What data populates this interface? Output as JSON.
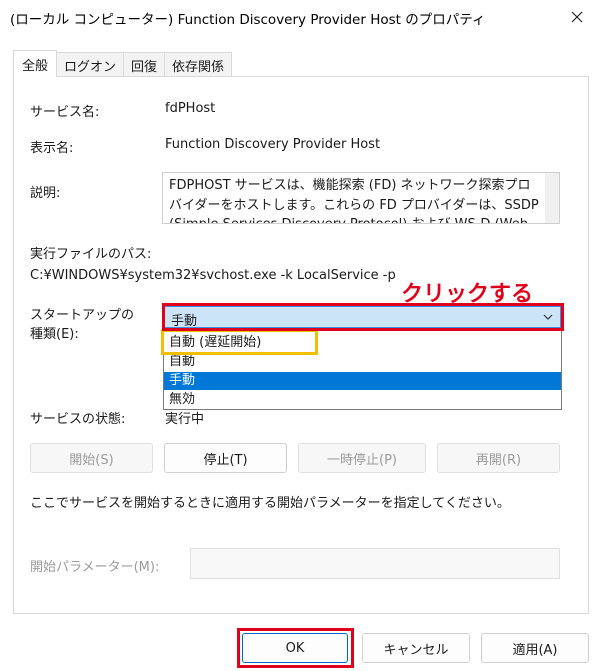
{
  "window": {
    "title": "(ローカル コンピューター) Function Discovery Provider Host のプロパティ",
    "close_icon": "close-icon"
  },
  "tabs": [
    {
      "label": "全般",
      "active": true
    },
    {
      "label": "ログオン",
      "active": false
    },
    {
      "label": "回復",
      "active": false
    },
    {
      "label": "依存関係",
      "active": false
    }
  ],
  "general": {
    "service_name_label": "サービス名:",
    "service_name_value": "fdPHost",
    "display_name_label": "表示名:",
    "display_name_value": "Function Discovery Provider Host",
    "description_label": "説明:",
    "description_text": "FDPHOST サービスは、機能探索 (FD) ネットワーク探索プロバイダーをホストします。これらの FD プロバイダーは、SSDP (Simple Services Discovery Protocol) および WS-D (Web",
    "exec_path_label": "実行ファイルのパス:",
    "exec_path_value": "C:¥WINDOWS¥system32¥svchost.exe -k LocalService -p",
    "startup_type_label_line1": "スタートアップの",
    "startup_type_label_line2": "種類(E):",
    "startup_type_selected": "手動",
    "startup_options": [
      "自動 (遅延開始)",
      "自動",
      "手動",
      "無効"
    ],
    "startup_highlighted_option": "手動",
    "service_status_label": "サービスの状態:",
    "service_status_value": "実行中"
  },
  "service_buttons": {
    "start": "開始(S)",
    "stop": "停止(T)",
    "pause": "一時停止(P)",
    "resume": "再開(R)"
  },
  "params": {
    "hint": "ここでサービスを開始するときに適用する開始パラメーターを指定してください。",
    "label": "開始パラメーター(M):",
    "value": ""
  },
  "dialog_buttons": {
    "ok": "OK",
    "cancel": "キャンセル",
    "apply": "適用(A)"
  },
  "annotation": {
    "text": "クリックする",
    "color": "#e0001b",
    "highlight_color": "#f0c000"
  },
  "colors": {
    "selection_blue": "#0078d7",
    "combo_bg": "#cce4f7"
  }
}
